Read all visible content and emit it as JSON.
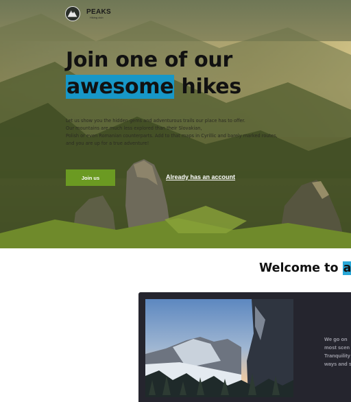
{
  "brand": {
    "name": "PEAKS",
    "tagline": "Hiking club"
  },
  "hero": {
    "headline_line1": "Join one of our",
    "headline_highlight": "awesome",
    "headline_rest": " hikes",
    "intro_lines": [
      "Let us show you the hidden gems and adventurous trails our place has to offer.",
      "Our mountains are much less explored than their Slovakian,",
      "Polish or even Romanian counterparts. Add to that maps in Cyrillic and barely marked routes,",
      "and you are up for a true adventure!"
    ],
    "join_label": "Join us",
    "account_link": "Already has an account"
  },
  "welcome": {
    "title_prefix": "Welcome to ",
    "title_highlight": "adv"
  },
  "card": {
    "text_lines": [
      "We go on",
      "most scen",
      "Tranquility",
      "ways and s"
    ]
  },
  "colors": {
    "accent_blue": "#1797c7",
    "join_green": "#6b9a22",
    "card_bg": "#25252e"
  },
  "icons": {
    "logo": "mountain-logo-icon"
  }
}
